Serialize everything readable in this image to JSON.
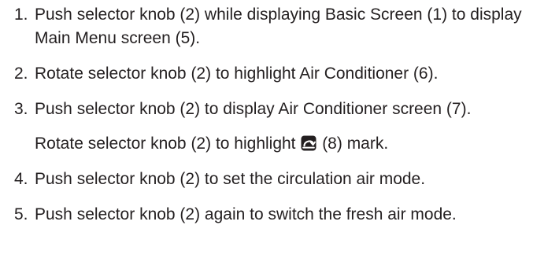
{
  "steps": [
    {
      "num": "1.",
      "text": "Push selector knob (2) while displaying Basic Screen (1) to display Main Menu screen (5)."
    },
    {
      "num": "2.",
      "text": "Rotate selector knob (2) to highlight Air Conditioner (6)."
    },
    {
      "num": "3.",
      "text": "Push selector knob (2) to display Air Conditioner screen (7).",
      "sub": {
        "before": "Rotate selector knob (2) to highlight ",
        "icon": "air-recirculation-icon",
        "after": " (8) mark."
      }
    },
    {
      "num": "4.",
      "text": "Push selector knob (2) to set the circulation air mode."
    },
    {
      "num": "5.",
      "text": "Push selector knob (2) again to switch the fresh air mode."
    }
  ]
}
